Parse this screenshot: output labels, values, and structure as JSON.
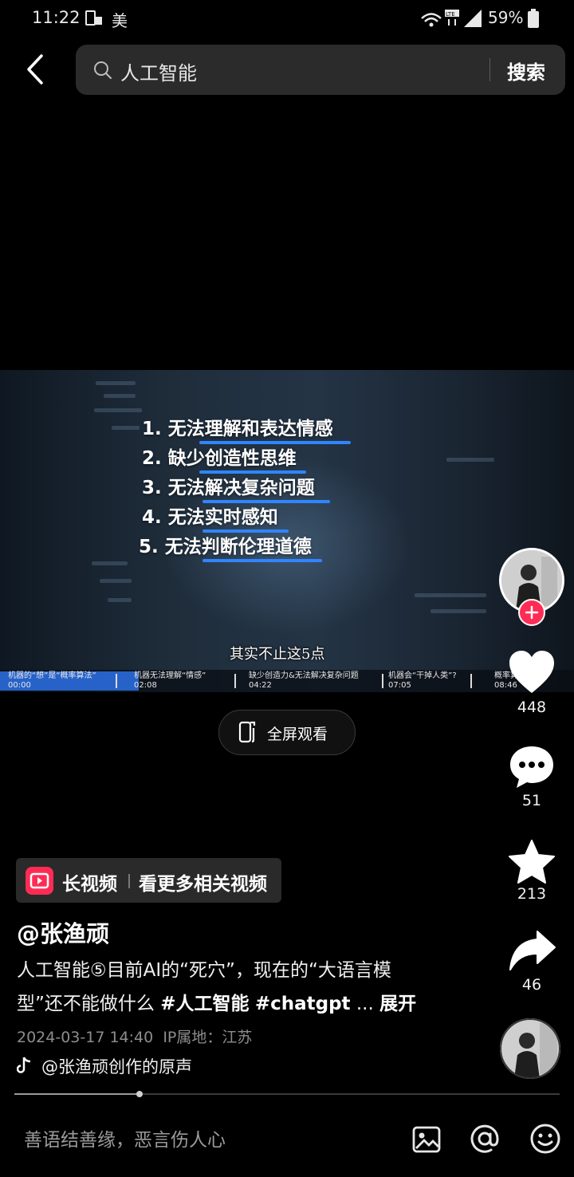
{
  "status_bar": {
    "time": "11:22",
    "carrier": "美",
    "battery": "59%",
    "lte": "LTE"
  },
  "header": {
    "query": "人工智能",
    "search_label": "搜索"
  },
  "video": {
    "list": [
      {
        "num": "1.",
        "text": "无法理解和表达情感"
      },
      {
        "num": "2.",
        "text": "缺少创造性思维"
      },
      {
        "num": "3.",
        "text": "无法解决复杂问题"
      },
      {
        "num": "4.",
        "text": "无法实时感知"
      },
      {
        "num": "5.",
        "text": "无法判断伦理道德"
      }
    ],
    "subtitle": "其实不止这5点",
    "chapters": [
      {
        "title": "机器的“想”是“概率算法”",
        "time": "00:00"
      },
      {
        "title": "机器无法理解“情感”",
        "time": "02:08"
      },
      {
        "title": "缺少创造力&无法解决复杂问题",
        "time": "04:22"
      },
      {
        "title": "机器会“干掉人类”?",
        "time": "07:05"
      },
      {
        "title": "概率算法原理",
        "time": "08:46"
      }
    ]
  },
  "fullscreen_label": "全屏观看",
  "rail": {
    "likes": "448",
    "comments": "51",
    "favorites": "213",
    "shares": "46"
  },
  "long_video": {
    "title": "长视频",
    "more": "看更多相关视频"
  },
  "post": {
    "author": "@张渔顽",
    "desc_line1": "人工智能⑤目前AI的“死穴”，现在的“大语言模",
    "desc_line2_text": "型”还不能做什么 ",
    "tag1": "#人工智能",
    "tag2": "#chatgpt",
    "ellipsis": " ... ",
    "expand": "展开",
    "date": "2024-03-17 14:40",
    "location": "IP属地：江苏",
    "music": "@张渔顽创作的原声"
  },
  "progress": 0.23,
  "comment_placeholder": "善语结善缘，恶言伤人心",
  "colors": {
    "accent": "#fe2c55",
    "underline": "#2f86ff",
    "chapter_active": "#2762c9"
  }
}
